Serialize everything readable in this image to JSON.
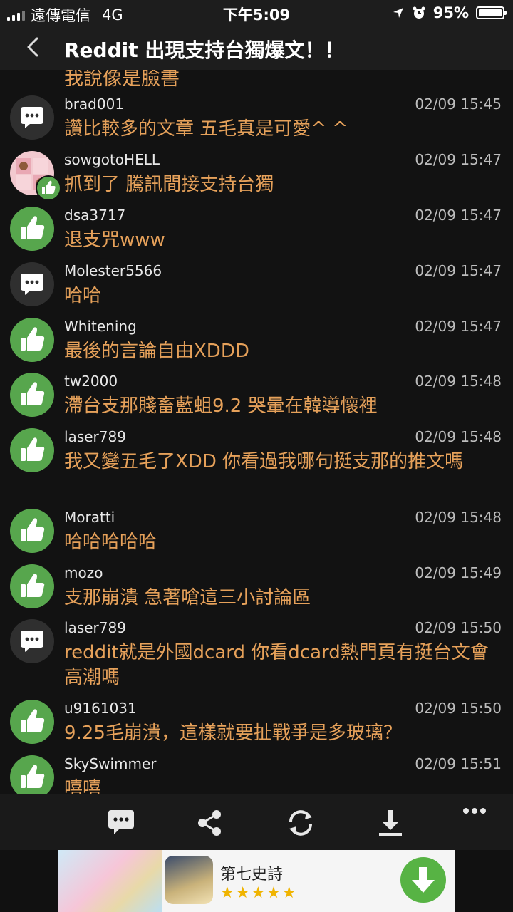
{
  "status_bar": {
    "carrier": "遠傳電信",
    "network": "4G",
    "time": "下午5:09",
    "battery": "95%"
  },
  "nav": {
    "back_icon": "chevron-left-icon",
    "title": "Reddit 出現支持台獨爆文！！"
  },
  "overflow_text": "我說像是臉書",
  "comments": [
    {
      "user": "brad001",
      "time": "02/09 15:45",
      "text": "讚比較多的文章 五毛真是可愛^ ^",
      "icon": "chat"
    },
    {
      "user": "sowgotoHELL",
      "time": "02/09 15:47",
      "text": "抓到了 騰訊間接支持台獨",
      "icon": "photo-like"
    },
    {
      "user": "dsa3717",
      "time": "02/09 15:47",
      "text": "退支咒www",
      "icon": "like"
    },
    {
      "user": "Molester5566",
      "time": "02/09 15:47",
      "text": "哈哈",
      "icon": "chat"
    },
    {
      "user": "Whitening",
      "time": "02/09 15:47",
      "text": "最後的言論自由XDDD",
      "icon": "like"
    },
    {
      "user": "tw2000",
      "time": "02/09 15:48",
      "text": "滯台支那賤畜藍蛆9.2 哭暈在韓導懷裡",
      "icon": "like"
    },
    {
      "user": "laser789",
      "time": "02/09 15:48",
      "text": "我又變五毛了XDD 你看過我哪句挺支那的推文嗎",
      "icon": "like"
    },
    {
      "user": "Moratti",
      "time": "02/09 15:48",
      "text": "哈哈哈哈哈",
      "icon": "like"
    },
    {
      "user": "mozo",
      "time": "02/09 15:49",
      "text": "支那崩潰 急著嗆這三小討論區",
      "icon": "like"
    },
    {
      "user": "laser789",
      "time": "02/09 15:50",
      "text": "reddit就是外國dcard 你看dcard熱門頁有挺台文會高潮嗎",
      "icon": "chat"
    },
    {
      "user": "u9161031",
      "time": "02/09 15:50",
      "text": "9.25毛崩潰，這樣就要扯戰爭是多玻璃？",
      "icon": "like"
    },
    {
      "user": "SkySwimmer",
      "time": "02/09 15:51",
      "text": "嘻嘻",
      "icon": "like"
    }
  ],
  "toolbar": {
    "items": [
      "comment-icon",
      "share-icon",
      "refresh-icon",
      "download-icon",
      "more-icon"
    ]
  },
  "ad": {
    "app_name": "第七史詩",
    "rating": 4.5,
    "stars": "★★★★★"
  },
  "colors": {
    "background": "#121212",
    "comment_text": "#e6a15a",
    "like_green": "#57a64d",
    "bar": "#1d1d1d"
  }
}
